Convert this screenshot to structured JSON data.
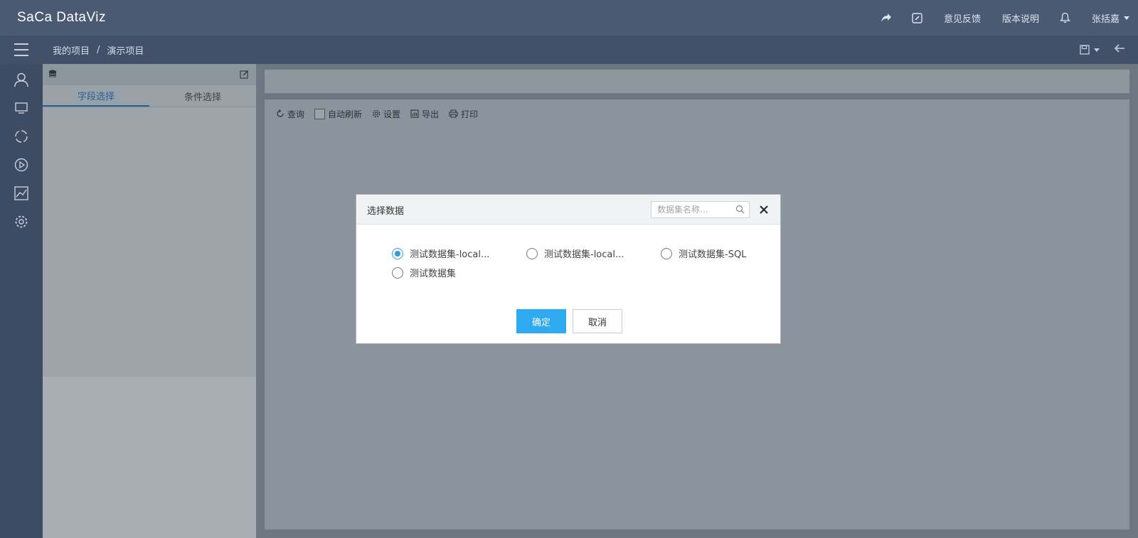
{
  "header": {
    "logo": "SaCa DataViz",
    "feedback": "意见反馈",
    "release_notes": "版本说明",
    "user": "张括嘉",
    "icons": [
      "share-icon",
      "edit-icon",
      "bell-icon"
    ]
  },
  "breadcrumb": {
    "items": [
      "我的项目",
      "演示项目"
    ],
    "separator": "/"
  },
  "sidebar": {
    "icons": [
      "user-icon",
      "monitor-icon",
      "refresh-circle-icon",
      "play-icon",
      "chart-icon",
      "settings-icon"
    ]
  },
  "field_panel": {
    "tabs": [
      {
        "label": "字段选择",
        "active": true
      },
      {
        "label": "条件选择",
        "active": false
      }
    ]
  },
  "toolbar": {
    "query": "查询",
    "auto_refresh": "自动刷新",
    "settings": "设置",
    "export": "导出",
    "print": "打印"
  },
  "modal": {
    "title": "选择数据",
    "search_placeholder": "数据集名称...",
    "options": [
      {
        "label": "测试数据集-local...",
        "checked": true
      },
      {
        "label": "测试数据集-local...",
        "checked": false
      },
      {
        "label": "测试数据集-SQL",
        "checked": false
      },
      {
        "label": "测试数据集",
        "checked": false
      }
    ],
    "confirm": "确定",
    "cancel": "取消"
  },
  "colors": {
    "primary": "#2eaaf0",
    "header_bg": "#4a5a72",
    "active_tab": "#22639e"
  }
}
